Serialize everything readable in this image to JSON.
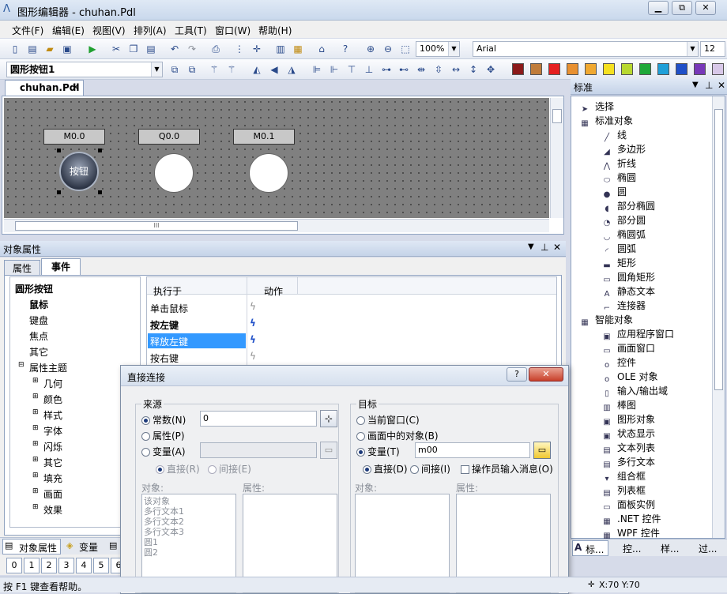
{
  "window": {
    "title": "图形编辑器 - chuhan.Pdl",
    "min": "▭",
    "max": "⧉",
    "close": "✕"
  },
  "menu": [
    "文件(F)",
    "编辑(E)",
    "视图(V)",
    "排列(A)",
    "工具(T)",
    "窗口(W)",
    "帮助(H)"
  ],
  "toolbar1": {
    "zoom": "100%",
    "font": "Arial",
    "font_size": "12"
  },
  "toolbar2": {
    "object_select": "圆形按钮1",
    "swatches": [
      "#8b1a1a",
      "#c07c3a",
      "#e52020",
      "#e89030",
      "#f0a830",
      "#f5e020",
      "#b8d830",
      "#20a838",
      "#20a0d8",
      "#2050c8",
      "#7838b8",
      "#d8c8e8"
    ]
  },
  "document_tab": {
    "label": "chuhan.Pdl",
    "close": "✕"
  },
  "canvas": {
    "items": [
      {
        "label": "M0.0",
        "type": "button",
        "text": "按钮"
      },
      {
        "label": "Q0.0",
        "type": "lamp"
      },
      {
        "label": "M0.1",
        "type": "lamp"
      }
    ],
    "scroll_marker": "III"
  },
  "props_panel": {
    "title": "对象属性",
    "tabs": [
      "属性",
      "事件"
    ],
    "tree": [
      "圆形按钮",
      "鼠标",
      "键盘",
      "焦点",
      "其它",
      "属性主题",
      "几何",
      "颜色",
      "样式",
      "字体",
      "闪烁",
      "其它",
      "填充",
      "画面",
      "效果"
    ],
    "event_cols": [
      "执行于",
      "动作"
    ],
    "events": [
      "单击鼠标",
      "按左键",
      "释放左键",
      "按右键"
    ],
    "bottom_tabs": [
      "对象属性",
      "变量"
    ],
    "numbers": [
      "0",
      "1",
      "2",
      "3",
      "4",
      "5",
      "6"
    ]
  },
  "right_panel": {
    "title": "标准",
    "items": [
      "选择",
      "标准对象",
      "线",
      "多边形",
      "折线",
      "椭圆",
      "圆",
      "部分椭圆",
      "部分圆",
      "椭圆弧",
      "圆弧",
      "矩形",
      "圆角矩形",
      "静态文本",
      "连接器",
      "智能对象",
      "应用程序窗口",
      "画面窗口",
      "控件",
      "OLE 对象",
      "输入/输出域",
      "棒图",
      "图形对象",
      "状态显示",
      "文本列表",
      "多行文本",
      "组合框",
      "列表框",
      "面板实例",
      ".NET 控件",
      "WPF 控件"
    ],
    "bottom_tabs": [
      "标...",
      "控...",
      "样...",
      "过..."
    ]
  },
  "dialog": {
    "title": "直接连接",
    "help": "?",
    "close": "✕",
    "source": {
      "title": "来源",
      "const_label": "常数(N)",
      "const_value": "0",
      "prop_label": "属性(P)",
      "var_label": "变量(A)",
      "direct": "直接(R)",
      "indirect": "间接(E)",
      "obj_col": "对象:",
      "prop_col": "属性:",
      "objects": [
        "该对象",
        "多行文本1",
        "多行文本2",
        "多行文本3",
        "圆1",
        "圆2"
      ]
    },
    "target": {
      "title": "目标",
      "cur_win": "当前窗口(C)",
      "pic_obj": "画面中的对象(B)",
      "var_label": "变量(T)",
      "var_value": "m00",
      "direct": "直接(D)",
      "indirect": "间接(I)",
      "operator_msg": "操作员输入消息(O)",
      "obj_col": "对象:",
      "prop_col": "属性:"
    }
  },
  "status": {
    "help": "按 F1 键查看帮助。",
    "coords": "X:70 Y:70"
  }
}
